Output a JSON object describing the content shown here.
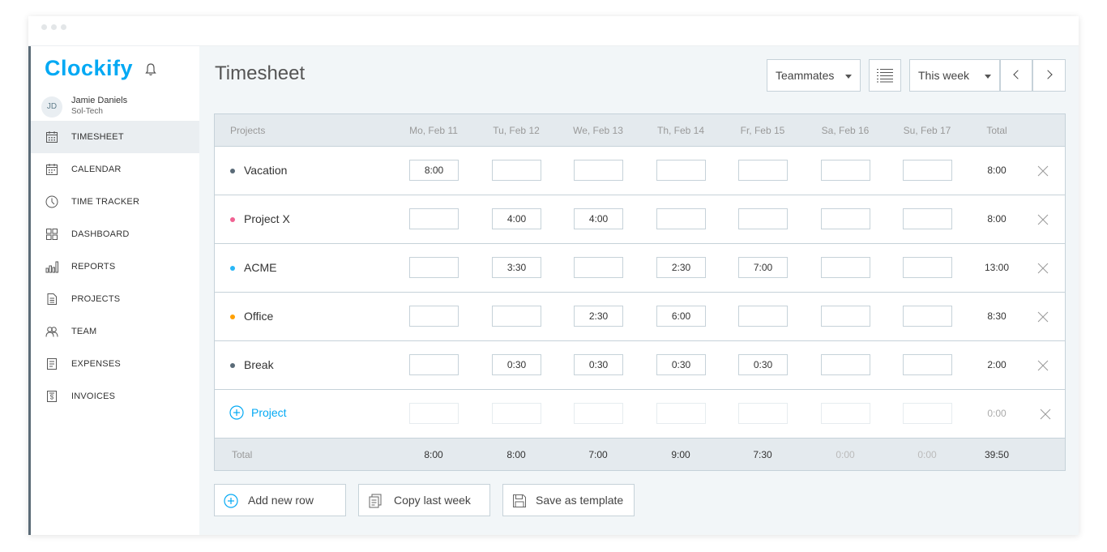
{
  "app": {
    "name": "Clockify"
  },
  "user": {
    "initials": "JD",
    "name": "Jamie Daniels",
    "org": "Sol-Tech"
  },
  "nav": [
    {
      "label": "TIMESHEET",
      "icon": "timesheet-icon",
      "active": true
    },
    {
      "label": "CALENDAR",
      "icon": "calendar-icon",
      "active": false
    },
    {
      "label": "TIME TRACKER",
      "icon": "clock-icon",
      "active": false
    },
    {
      "label": "DASHBOARD",
      "icon": "dashboard-icon",
      "active": false
    },
    {
      "label": "REPORTS",
      "icon": "reports-icon",
      "active": false
    },
    {
      "label": "PROJECTS",
      "icon": "projects-icon",
      "active": false
    },
    {
      "label": "TEAM",
      "icon": "team-icon",
      "active": false
    },
    {
      "label": "EXPENSES",
      "icon": "expenses-icon",
      "active": false
    },
    {
      "label": "INVOICES",
      "icon": "invoices-icon",
      "active": false
    }
  ],
  "header": {
    "title": "Timesheet",
    "teammates_label": "Teammates",
    "week_label": "This week"
  },
  "table": {
    "columns": [
      "Projects",
      "Mo, Feb 11",
      "Tu, Feb 12",
      "We, Feb 13",
      "Th, Feb 14",
      "Fr, Feb 15",
      "Sa, Feb 16",
      "Su, Feb 17",
      "Total"
    ],
    "rows": [
      {
        "project": "Vacation",
        "color": "#5a6b78",
        "cells": [
          "8:00",
          "",
          "",
          "",
          "",
          "",
          ""
        ],
        "total": "8:00"
      },
      {
        "project": "Project X",
        "color": "#f06292",
        "cells": [
          "",
          "4:00",
          "4:00",
          "",
          "",
          "",
          ""
        ],
        "total": "8:00"
      },
      {
        "project": "ACME",
        "color": "#29b6f6",
        "cells": [
          "",
          "3:30",
          "",
          "2:30",
          "7:00",
          "",
          ""
        ],
        "total": "13:00"
      },
      {
        "project": "Office",
        "color": "#ffa000",
        "cells": [
          "",
          "",
          "2:30",
          "6:00",
          "",
          "",
          ""
        ],
        "total": "8:30"
      },
      {
        "project": "Break",
        "color": "#5a6b78",
        "cells": [
          "",
          "0:30",
          "0:30",
          "0:30",
          "0:30",
          "",
          ""
        ],
        "total": "2:00"
      }
    ],
    "add_project_label": "Project",
    "add_project_total": "0:00",
    "footer_label": "Total",
    "footer_totals": [
      "8:00",
      "8:00",
      "7:00",
      "9:00",
      "7:30",
      "0:00",
      "0:00"
    ],
    "footer_grand_total": "39:50"
  },
  "actions": {
    "add_row": "Add new row",
    "copy_last_week": "Copy last week",
    "save_template": "Save as template"
  },
  "colors": {
    "accent": "#03a9f4",
    "border": "#c6d2d9",
    "header_bg": "#e4eaee",
    "page_bg": "#f2f6f8"
  }
}
